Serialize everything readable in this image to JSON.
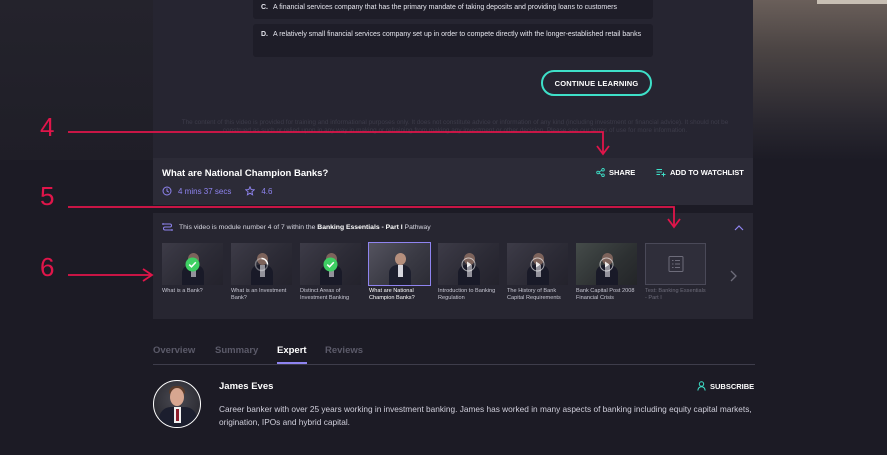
{
  "quiz": {
    "option_c": {
      "letter": "C.",
      "text": "A financial services company that has the primary mandate of taking deposits and providing loans to customers"
    },
    "option_d": {
      "letter": "D.",
      "text": "A relatively small financial services company set up in order to compete directly with the longer-established retail banks"
    },
    "continue_label": "CONTINUE LEARNING",
    "disclaimer": "The content of this video is provided for training and informational purposes only. It does not constitute advice or information of any kind (including investment or financial advice). It should not be construed as such or relied upon in any way in making or refraining from making any investment or other decision. Please see our terms of use for more information."
  },
  "video": {
    "title": "What are National Champion Banks?",
    "duration": "4 mins 37 secs",
    "rating": "4.6",
    "share_label": "SHARE",
    "watchlist_label": "ADD TO WATCHLIST"
  },
  "pathway": {
    "text_prefix": "This video is module number 4 of 7 within the ",
    "pathway_name": "Banking Essentials - Part I",
    "text_suffix": " Pathway",
    "modules": [
      {
        "caption": "What is a Bank?",
        "status": "completed"
      },
      {
        "caption": "What is an Investment Bank?",
        "status": "in-progress"
      },
      {
        "caption": "Distinct Areas of Investment Banking",
        "status": "completed"
      },
      {
        "caption": "What are National Champion Banks?",
        "status": "current"
      },
      {
        "caption": "Introduction to Banking Regulation",
        "status": "play"
      },
      {
        "caption": "The History of Bank Capital Requirements",
        "status": "play"
      },
      {
        "caption": "Bank Capital Post 2008 Financial Crisis",
        "status": "play"
      },
      {
        "caption": "Test: Banking Essentials - Part I",
        "status": "test"
      }
    ]
  },
  "tabs": [
    {
      "label": "Overview",
      "active": false
    },
    {
      "label": "Summary",
      "active": false
    },
    {
      "label": "Expert",
      "active": true
    },
    {
      "label": "Reviews",
      "active": false
    }
  ],
  "expert": {
    "name": "James Eves",
    "subscribe_label": "SUBSCRIBE",
    "bio": "Career banker with over 25 years working in investment banking. James has worked in many aspects of banking including equity capital markets, origination, IPOs and hybrid capital."
  },
  "annotations": [
    "4",
    "5",
    "6"
  ],
  "colors": {
    "accent": "#8f84f0",
    "teal": "#3ee0c8",
    "annotation": "#e0154a",
    "check": "#3ecf63"
  }
}
